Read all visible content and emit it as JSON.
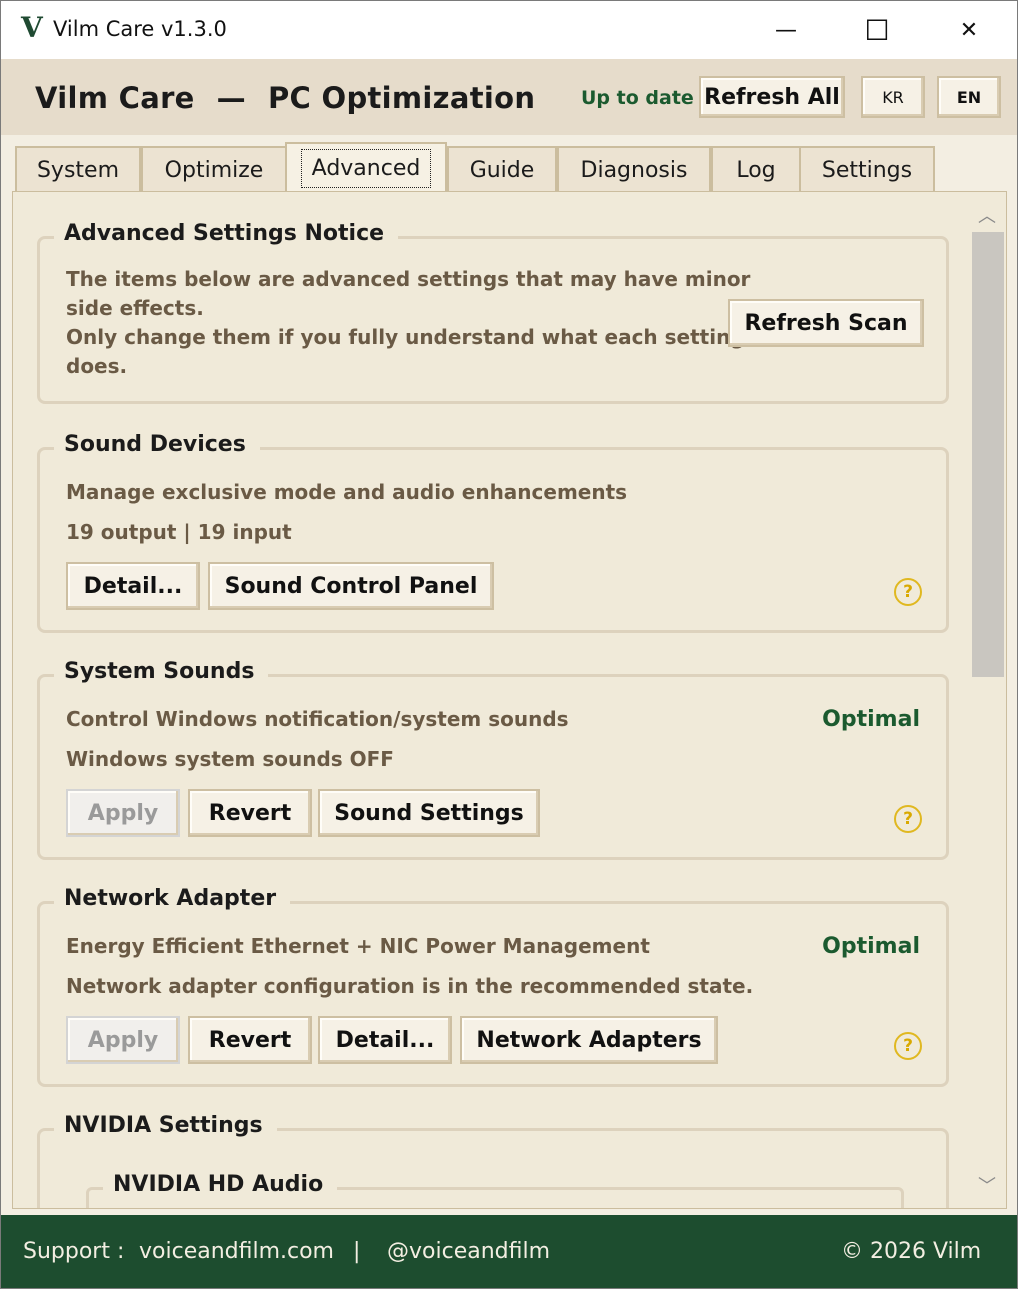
{
  "window": {
    "title": "Vilm Care v1.3.0",
    "logo": "V",
    "minimize": "—",
    "maximize": "☐",
    "close": "✕"
  },
  "header": {
    "app_name": "Vilm Care",
    "dash": "—",
    "subtitle": "PC Optimization",
    "status": "Up to date",
    "refresh_all": "Refresh All",
    "lang_kr": "KR",
    "lang_en": "EN"
  },
  "tabs": [
    "System",
    "Optimize",
    "Advanced",
    "Guide",
    "Diagnosis",
    "Log",
    "Settings"
  ],
  "active_tab": "Advanced",
  "sections": {
    "notice": {
      "title": "Advanced Settings Notice",
      "line1": "The items below are advanced settings that may have minor",
      "line2": "side effects.",
      "line3": "Only change them if you fully understand what each setting",
      "line4": "does.",
      "refresh_scan": "Refresh Scan"
    },
    "sound_devices": {
      "title": "Sound Devices",
      "description": "Manage exclusive mode and audio enhancements",
      "status": "19 output | 19 input",
      "detail_button": "Detail...",
      "panel_button": "Sound Control Panel",
      "help": "?"
    },
    "system_sounds": {
      "title": "System Sounds",
      "description": "Control Windows notification/system sounds",
      "status": "Windows system sounds OFF",
      "state": "Optimal",
      "apply": "Apply",
      "revert": "Revert",
      "settings_button": "Sound Settings",
      "help": "?"
    },
    "network_adapter": {
      "title": "Network Adapter",
      "description": "Energy Efficient Ethernet + NIC Power Management",
      "status": "Network adapter configuration is in the recommended state.",
      "state": "Optimal",
      "apply": "Apply",
      "revert": "Revert",
      "detail_button": "Detail...",
      "adapters_button": "Network Adapters",
      "help": "?"
    },
    "nvidia": {
      "title": "NVIDIA Settings",
      "sub_title": "NVIDIA HD Audio"
    }
  },
  "scroll": {
    "up": "︿",
    "down": "﹀"
  },
  "footer": {
    "support_label": "Support :",
    "site": "voiceandfilm.com",
    "separator": "|",
    "handle": "@voiceandfilm",
    "copyright": "© 2026 Vilm"
  },
  "colors": {
    "accent_green": "#1b5a2f",
    "footer_bg": "#1d4d2f",
    "help_yellow": "#e0b820"
  }
}
